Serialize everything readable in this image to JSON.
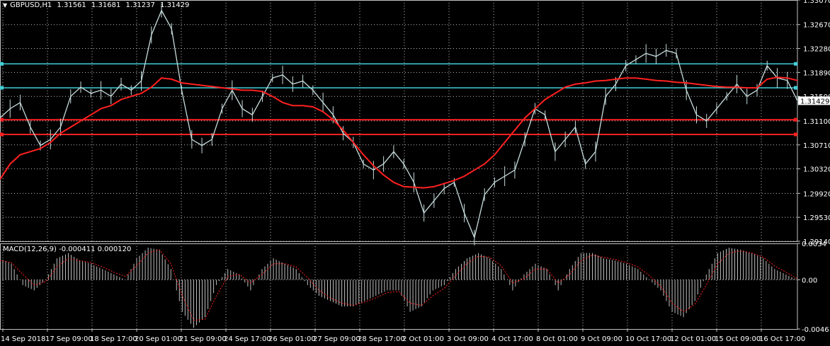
{
  "header": {
    "symbol": "GBPUSD,H1",
    "open": "1.31561",
    "high": "1.31681",
    "low": "1.31237",
    "close": "1.31429"
  },
  "indicator": {
    "label": "MACD(12,26,9) -0.000411 0.000120"
  },
  "colors": {
    "background": "#000000",
    "grid": "#c0c0c0",
    "price_line": "#c8dcdc",
    "moving_average": "#ff2020",
    "resistance": "#40d0d8",
    "support": "#ff2020",
    "macd_hist": "#c0c0c0",
    "macd_signal": "#ff2020",
    "current_price_box": "#ffffff"
  },
  "chart_data": [
    {
      "type": "line",
      "title": "GBPUSD,H1",
      "ylim": [
        1.2914,
        1.3307
      ],
      "y_ticks": [
        "1.33070",
        "1.32670",
        "1.32280",
        "1.31890",
        "1.31500",
        "1.31100",
        "1.30710",
        "1.30320",
        "1.29920",
        "1.29530",
        "1.29140"
      ],
      "current_price": "1.31429",
      "x_ticks": [
        "14 Sep 2018",
        "17 Sep 09:00",
        "18 Sep 17:00",
        "20 Sep 01:00",
        "21 Sep 09:00",
        "24 Sep 17:00",
        "26 Sep 01:00",
        "27 Sep 09:00",
        "28 Sep 17:00",
        "2 Oct 01:00",
        "3 Oct 09:00",
        "4 Oct 17:00",
        "8 Oct 01:00",
        "9 Oct 09:00",
        "10 Oct 17:00",
        "12 Oct 01:00",
        "15 Oct 09:00",
        "16 Oct 17:00"
      ],
      "horizontal_levels": [
        {
          "value": 1.3203,
          "color": "resistance"
        },
        {
          "value": 1.3164,
          "color": "resistance"
        },
        {
          "value": 1.3112,
          "color": "support"
        },
        {
          "value": 1.3088,
          "color": "support"
        }
      ],
      "series": [
        {
          "kind": "price",
          "values": [
            1.3115,
            1.313,
            1.314,
            1.31,
            1.307,
            1.308,
            1.31,
            1.315,
            1.3165,
            1.3155,
            1.316,
            1.315,
            1.317,
            1.316,
            1.3175,
            1.325,
            1.329,
            1.326,
            1.316,
            1.308,
            1.307,
            1.308,
            1.313,
            1.316,
            1.313,
            1.312,
            1.315,
            1.318,
            1.3185,
            1.317,
            1.3175,
            1.316,
            1.314,
            1.312,
            1.309,
            1.3075,
            1.304,
            1.303,
            1.304,
            1.306,
            1.304,
            1.301,
            1.296,
            1.298,
            1.3,
            1.301,
            1.296,
            1.292,
            1.299,
            1.301,
            1.302,
            1.303,
            1.308,
            1.313,
            1.312,
            1.306,
            1.308,
            1.31,
            1.304,
            1.306,
            1.315,
            1.317,
            1.32,
            1.321,
            1.322,
            1.3215,
            1.3225,
            1.322,
            1.316,
            1.312,
            1.311,
            1.313,
            1.315,
            1.317,
            1.315,
            1.316,
            1.32,
            1.318,
            1.3176,
            1.3143
          ]
        },
        {
          "kind": "moving_average",
          "values": [
            1.3015,
            1.304,
            1.3055,
            1.306,
            1.3065,
            1.3075,
            1.309,
            1.31,
            1.311,
            1.312,
            1.313,
            1.3135,
            1.3145,
            1.315,
            1.3155,
            1.3165,
            1.318,
            1.3178,
            1.3172,
            1.317,
            1.3168,
            1.3166,
            1.3164,
            1.3162,
            1.316,
            1.316,
            1.3158,
            1.315,
            1.314,
            1.3135,
            1.3135,
            1.3133,
            1.3125,
            1.3112,
            1.3095,
            1.3075,
            1.3055,
            1.3037,
            1.3022,
            1.301,
            1.3003,
            1.3002,
            1.3001,
            1.3003,
            1.3008,
            1.3013,
            1.302,
            1.303,
            1.304,
            1.3055,
            1.3075,
            1.3095,
            1.3115,
            1.313,
            1.3145,
            1.3155,
            1.3165,
            1.317,
            1.3172,
            1.3175,
            1.3176,
            1.3178,
            1.318,
            1.318,
            1.3178,
            1.3176,
            1.3175,
            1.3173,
            1.3172,
            1.317,
            1.3168,
            1.3166,
            1.3165,
            1.3165,
            1.3164,
            1.3164,
            1.3178,
            1.3181,
            1.318,
            1.3176
          ]
        }
      ]
    },
    {
      "type": "bar",
      "title": "MACD(12,26,9) -0.000411 0.000120",
      "ylim": [
        -0.004615,
        0.0034
      ],
      "y_ticks": [
        "0.0034",
        "0.00",
        "-0.004615"
      ],
      "series": [
        {
          "kind": "histogram",
          "values": [
            0.002,
            0.0015,
            -0.0005,
            -0.001,
            0.0,
            0.002,
            0.0025,
            0.0018,
            0.0015,
            0.001,
            0.0005,
            0.0,
            0.002,
            0.003,
            0.0028,
            0.001,
            -0.003,
            -0.0045,
            -0.0035,
            -0.0005,
            0.001,
            0.0005,
            -0.001,
            0.001,
            0.002,
            0.0015,
            0.001,
            -0.0005,
            -0.0015,
            -0.002,
            -0.0025,
            -0.0025,
            -0.002,
            -0.0015,
            -0.001,
            -0.001,
            -0.003,
            -0.0025,
            -0.001,
            -0.0005,
            0.001,
            0.002,
            0.0025,
            0.002,
            0.001,
            -0.001,
            0.0005,
            0.0015,
            0.001,
            -0.001,
            0.001,
            0.0025,
            0.0025,
            0.002,
            0.0018,
            0.0015,
            0.001,
            0.0,
            -0.001,
            -0.003,
            -0.0035,
            -0.002,
            0.0005,
            0.0025,
            0.003,
            0.0028,
            0.0025,
            0.002,
            0.001,
            0.0005,
            0.0
          ]
        },
        {
          "kind": "signal",
          "values": [
            0.0018,
            0.0016,
            0.0005,
            -0.0005,
            -0.0002,
            0.0012,
            0.002,
            0.0018,
            0.0016,
            0.0012,
            0.0007,
            0.0003,
            0.0013,
            0.0025,
            0.0028,
            0.0015,
            -0.0015,
            -0.0038,
            -0.0037,
            -0.0015,
            0.0003,
            0.0005,
            -0.0003,
            0.0005,
            0.0015,
            0.0015,
            0.0012,
            0.0002,
            -0.001,
            -0.0017,
            -0.0022,
            -0.0024,
            -0.0021,
            -0.0017,
            -0.0012,
            -0.0011,
            -0.0022,
            -0.0024,
            -0.0015,
            -0.0008,
            0.0004,
            0.0015,
            0.0022,
            0.0021,
            0.0013,
            -0.0003,
            0.0001,
            0.001,
            0.001,
            -0.0003,
            0.0005,
            0.0018,
            0.0023,
            0.0021,
            0.0019,
            0.0016,
            0.0012,
            0.0004,
            -0.0006,
            -0.0022,
            -0.003,
            -0.0023,
            -0.0005,
            0.0015,
            0.0025,
            0.0027,
            0.0025,
            0.0021,
            0.0013,
            0.0007,
            0.0001
          ]
        }
      ]
    }
  ]
}
